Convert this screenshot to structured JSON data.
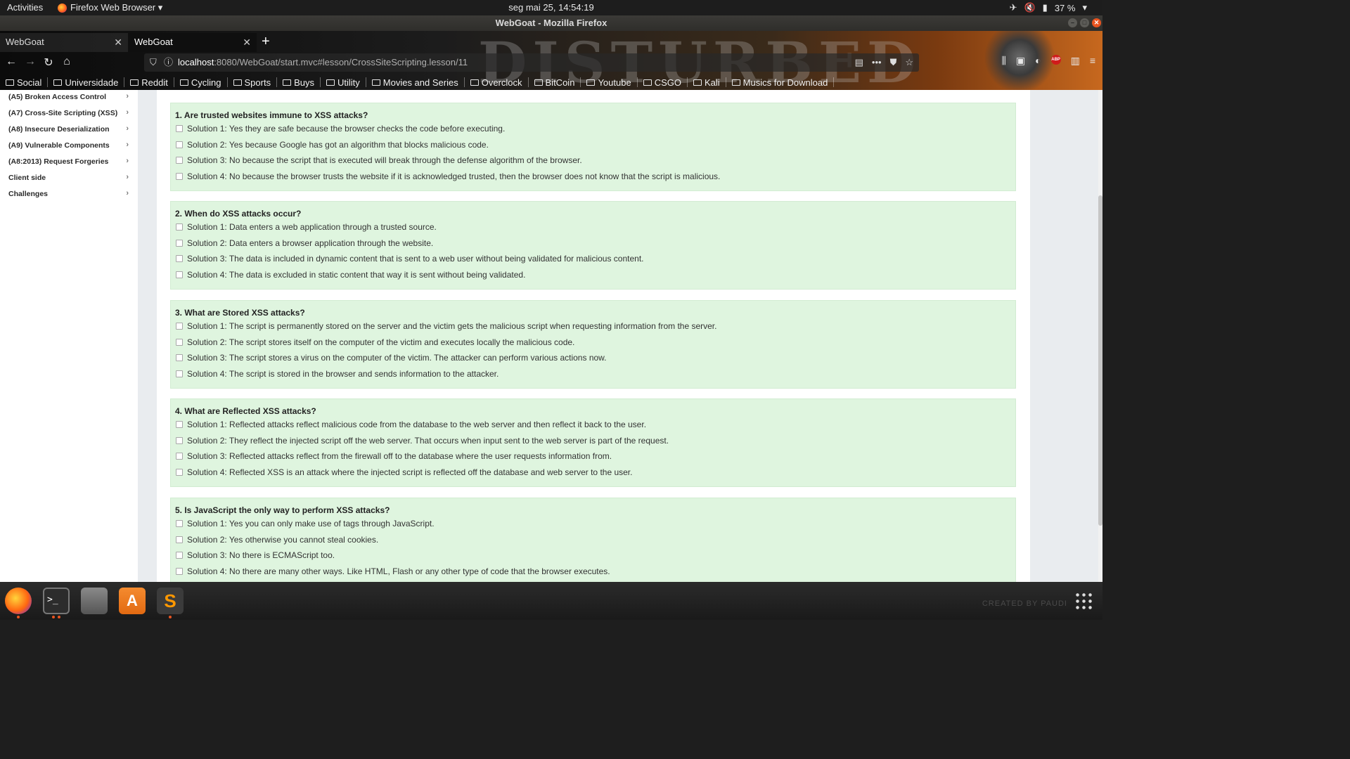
{
  "topbar": {
    "activities": "Activities",
    "app_menu": "Firefox Web Browser ▾",
    "clock": "seg mai 25, 14:54:19",
    "battery": "37 %"
  },
  "window": {
    "title": "WebGoat - Mozilla Firefox"
  },
  "tabs": [
    {
      "label": "WebGoat"
    },
    {
      "label": "WebGoat"
    }
  ],
  "url": {
    "host": "localhost",
    "path": ":8080/WebGoat/start.mvc#lesson/CrossSiteScripting.lesson/11"
  },
  "theme": {
    "word": "DISTURBED"
  },
  "bookmarks": [
    "Social",
    "Universidade",
    "Reddit",
    "Cycling",
    "Sports",
    "Buys",
    "Utility",
    "Movies and Series",
    "Overclock",
    "BitCoin",
    "Youtube",
    "CSGO",
    "Kali",
    "Musics for Download"
  ],
  "sidebar": {
    "items": [
      "(A5) Broken Access Control",
      "(A7) Cross-Site Scripting (XSS)",
      "(A8) Insecure Deserialization",
      "(A9) Vulnerable Components",
      "(A8:2013) Request Forgeries",
      "Client side",
      "Challenges"
    ]
  },
  "questions": [
    {
      "title": "1. Are trusted websites immune to XSS attacks?",
      "options": [
        "Solution 1: Yes they are safe because the browser checks the code before executing.",
        "Solution 2: Yes because Google has got an algorithm that blocks malicious code.",
        "Solution 3: No because the script that is executed will break through the defense algorithm of the browser.",
        "Solution 4: No because the browser trusts the website if it is acknowledged trusted, then the browser does not know that the script is malicious."
      ]
    },
    {
      "title": "2. When do XSS attacks occur?",
      "options": [
        "Solution 1: Data enters a web application through a trusted source.",
        "Solution 2: Data enters a browser application through the website.",
        "Solution 3: The data is included in dynamic content that is sent to a web user without being validated for malicious content.",
        "Solution 4: The data is excluded in static content that way it is sent without being validated."
      ]
    },
    {
      "title": "3. What are Stored XSS attacks?",
      "options": [
        "Solution 1: The script is permanently stored on the server and the victim gets the malicious script when requesting information from the server.",
        "Solution 2: The script stores itself on the computer of the victim and executes locally the malicious code.",
        "Solution 3: The script stores a virus on the computer of the victim. The attacker can perform various actions now.",
        "Solution 4: The script is stored in the browser and sends information to the attacker."
      ]
    },
    {
      "title": "4. What are Reflected XSS attacks?",
      "options": [
        "Solution 1: Reflected attacks reflect malicious code from the database to the web server and then reflect it back to the user.",
        "Solution 2: They reflect the injected script off the web server. That occurs when input sent to the web server is part of the request.",
        "Solution 3: Reflected attacks reflect from the firewall off to the database where the user requests information from.",
        "Solution 4: Reflected XSS is an attack where the injected script is reflected off the database and web server to the user."
      ]
    },
    {
      "title": "5. Is JavaScript the only way to perform XSS attacks?",
      "options": [
        "Solution 1: Yes you can only make use of tags through JavaScript.",
        "Solution 2: Yes otherwise you cannot steal cookies.",
        "Solution 3: No there is ECMAScript too.",
        "Solution 4: No there are many other ways. Like HTML, Flash or any other type of code that the browser executes."
      ]
    }
  ],
  "dock": {
    "terminal_glyph": ">_",
    "store_glyph": "A",
    "sublime_glyph": "S",
    "watermark": "CREATED BY PAUDI"
  }
}
